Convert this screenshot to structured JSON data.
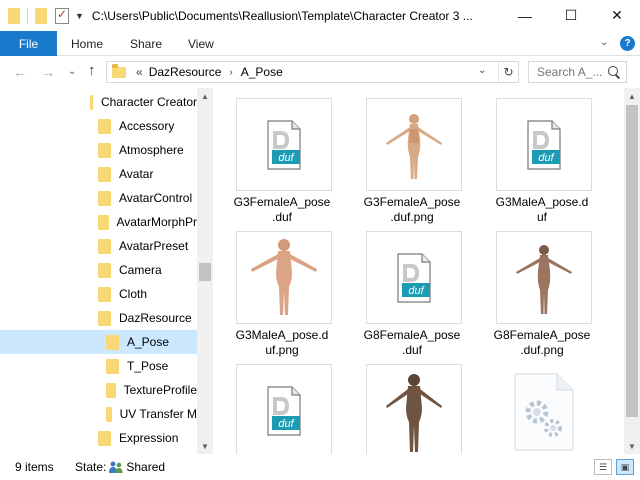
{
  "window": {
    "title": "C:\\Users\\Public\\Documents\\Reallusion\\Template\\Character Creator 3 ...",
    "minimize_glyph": "—",
    "maximize_glyph": "☐",
    "close_glyph": "✕"
  },
  "ribbon": {
    "tabs": [
      "File",
      "Home",
      "Share",
      "View"
    ],
    "expand_glyph": "⌄",
    "help_glyph": "?"
  },
  "address": {
    "back_glyph": "←",
    "forward_glyph": "→",
    "recent_glyph": "⌄",
    "up_glyph": "↑",
    "overflow": "«",
    "crumbs": [
      "DazResource",
      "A_Pose"
    ],
    "crumb_sep": "›",
    "dropdown_glyph": "⌄",
    "refresh_glyph": "↻",
    "search_placeholder": "Search A_..."
  },
  "tree": {
    "items": [
      {
        "label": "Character Creator"
      },
      {
        "label": "Accessory"
      },
      {
        "label": "Atmosphere"
      },
      {
        "label": "Avatar"
      },
      {
        "label": "AvatarControl"
      },
      {
        "label": "AvatarMorphPr"
      },
      {
        "label": "AvatarPreset"
      },
      {
        "label": "Camera"
      },
      {
        "label": "Cloth"
      },
      {
        "label": "DazResource"
      },
      {
        "label": "A_Pose"
      },
      {
        "label": "T_Pose"
      },
      {
        "label": "TextureProfile"
      },
      {
        "label": "UV Transfer M"
      },
      {
        "label": "Expression"
      }
    ],
    "scroll_up_glyph": "▲",
    "scroll_down_glyph": "▼"
  },
  "files": [
    {
      "name": "G3FemaleA_pose.duf",
      "line1": "G3FemaleA_pose",
      "line2": ".duf",
      "kind": "duf"
    },
    {
      "name": "G3FemaleA_pose.duf.png",
      "line1": "G3FemaleA_pose",
      "line2": ".duf.png",
      "kind": "figure-female-light"
    },
    {
      "name": "G3MaleA_pose.duf",
      "line1": "G3MaleA_pose.d",
      "line2": "uf",
      "kind": "duf"
    },
    {
      "name": "G3MaleA_pose.duf.png",
      "line1": "G3MaleA_pose.d",
      "line2": "uf.png",
      "kind": "figure-male-light"
    },
    {
      "name": "G8FemaleA_pose.duf",
      "line1": "G8FemaleA_pose",
      "line2": ".duf",
      "kind": "duf"
    },
    {
      "name": "G8FemaleA_pose.duf.png",
      "line1": "G8FemaleA_pose",
      "line2": ".duf.png",
      "kind": "figure-female-dark"
    },
    {
      "name": "",
      "line1": "",
      "line2": "",
      "kind": "duf"
    },
    {
      "name": "",
      "line1": "",
      "line2": "",
      "kind": "figure-male-dark"
    },
    {
      "name": "",
      "line1": "",
      "line2": "",
      "kind": "generic-gear"
    }
  ],
  "duf_text": "duf",
  "status": {
    "count": "9 items",
    "state_label": "State:",
    "state_value": "Shared"
  },
  "colors": {
    "accent": "#1979ca",
    "selection": "#cce8ff",
    "folder": "#f8d775",
    "duf_teal": "#1c9bb4"
  }
}
